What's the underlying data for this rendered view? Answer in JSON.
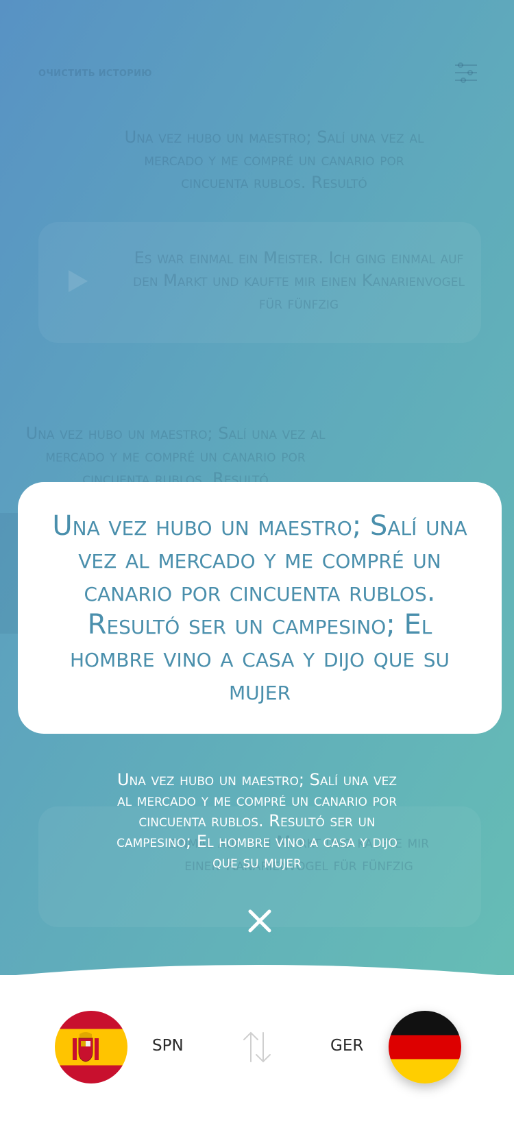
{
  "header": {
    "clear_history_label": "очистить историю",
    "filter_icon": "filter-sliders-icon"
  },
  "history": {
    "item1_source": "Una vez hubo un maestro; Salí una vez al mercado y me compré un canario por cincuenta rublos. Resultó",
    "item1_translation": "Es war einmal ein Meister. Ich ging einmal auf den Markt und kaufte mir einen Kanarienvogel für fünfzig",
    "item2_source": "Una vez hubo un maestro; Salí una vez al mercado y me compré un canario por cincuenta rublos. Resultó",
    "item3_translation_line2": "einmal auf den Markt und kaufte mir",
    "item3_translation_line3": "einen Kanarienvogel für fünfzig"
  },
  "modal": {
    "text": "Una vez hubo un maestro; Salí una vez al mercado y me compré un canario por cincuenta rublos. Resultó ser un campesino; El hombre vino a casa y dijo que su mujer"
  },
  "overlay": {
    "text": "Una vez hubo un maestro; Salí una vez al mercado y me compré un canario por cincuenta rublos. Resultó ser un campesino; El hombre vino a casa y dijo que su mujer",
    "close_icon": "close-icon"
  },
  "language_bar": {
    "source_lang": "SPN",
    "target_lang": "GER",
    "source_flag": "spain-flag-icon",
    "target_flag": "germany-flag-icon",
    "swap_icon": "swap-arrows-icon"
  },
  "colors": {
    "gradient_start": "#5892c4",
    "gradient_end": "#67c0b4",
    "modal_text": "#4a8fac",
    "flag_red": "#c8102e",
    "flag_yellow": "#ffc400"
  }
}
